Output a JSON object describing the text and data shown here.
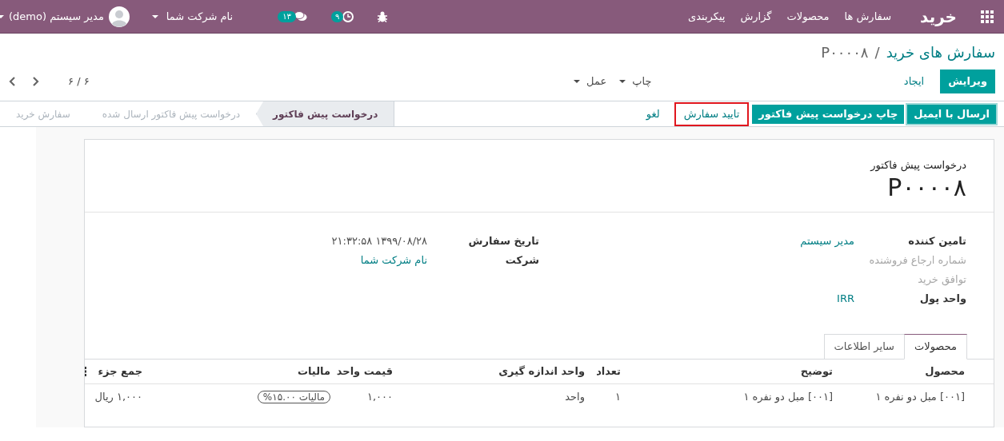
{
  "navbar": {
    "app": "خرید",
    "menu": [
      "سفارش ها",
      "محصولات",
      "گزارش",
      "پیکربندی"
    ],
    "activities_count": "۹",
    "messages_count": "۱۳",
    "company": "نام شرکت شما",
    "user": "مدیر سیستم (demo)"
  },
  "breadcrumb": {
    "parent": "سفارش های خرید",
    "separator": "/",
    "current": "P۰۰۰۰۸"
  },
  "control_panel": {
    "buttons": [
      {
        "label": "ویرایش",
        "kind": "primary"
      },
      {
        "label": "ایجاد",
        "kind": "link"
      }
    ],
    "dropdowns": [
      "چاپ",
      "عمل"
    ],
    "pager": "۶ / ۶"
  },
  "header_buttons": [
    {
      "label": "ارسال با ایمیل",
      "kind": "primary",
      "focused": true,
      "highlighted": false
    },
    {
      "label": "چاپ درخواست پیش فاکتور",
      "kind": "primary",
      "focused": false,
      "highlighted": false
    },
    {
      "label": "تایید سفارش",
      "kind": "secondary",
      "focused": false,
      "highlighted": true
    },
    {
      "label": "لغو",
      "kind": "link",
      "focused": false,
      "highlighted": false
    }
  ],
  "stages": [
    {
      "label": "درخواست پیش فاکتور",
      "selected": true
    },
    {
      "label": "درخواست پیش فاکتور ارسال شده",
      "selected": false
    },
    {
      "label": "سفارش خرید",
      "selected": false
    }
  ],
  "form": {
    "subtitle": "درخواست پیش فاکتور",
    "name": "P۰۰۰۰۸",
    "group_1": [
      {
        "label": "تامین کننده",
        "value": "مدیر سیستم",
        "link": true,
        "empty": false
      },
      {
        "label": "شماره ارجاع فروشنده",
        "empty": true
      },
      {
        "label": "توافق خرید",
        "empty": true
      },
      {
        "label": "واحد پول",
        "value": "IRR",
        "link": true,
        "empty": false
      }
    ],
    "group_2": [
      {
        "label": "تاریخ سفارش",
        "value": "۱۳۹۹/۰۸/۲۸ ۲۱:۳۲:۵۸",
        "link": false,
        "empty": false
      },
      {
        "label": "شرکت",
        "value": "نام شرکت شما",
        "link": true,
        "empty": false
      }
    ]
  },
  "tabs": [
    {
      "label": "محصولات",
      "selected": true
    },
    {
      "label": "سایر اطلاعات",
      "selected": false
    }
  ],
  "table": {
    "columns": [
      "محصول",
      "توضیح",
      "تعداد",
      "واحد اندازه گیری",
      "قیمت واحد",
      "مالیات",
      "جمع جزء"
    ],
    "rows": [
      {
        "cells": [
          {
            "text": "[۰۰۱] مبل دو نفره ۱",
            "kind": "text"
          },
          {
            "text": "[۰۰۱] مبل دو نفره ۱",
            "kind": "text"
          },
          {
            "text": "۱",
            "kind": "text"
          },
          {
            "text": "واحد",
            "kind": "text"
          },
          {
            "text": "۱,۰۰۰",
            "kind": "text"
          },
          {
            "text": "مالیات ۱۵.۰۰%",
            "kind": "tag"
          },
          {
            "text": "۱,۰۰۰ ریال",
            "kind": "text"
          }
        ]
      }
    ]
  }
}
